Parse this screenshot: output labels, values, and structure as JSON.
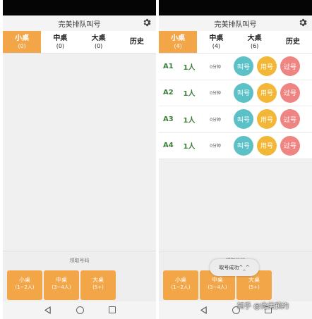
{
  "app_title": "完美排队叫号",
  "left_screen": {
    "tabs": [
      {
        "label": "小桌",
        "count": "(0)"
      },
      {
        "label": "中桌",
        "count": "(0)"
      },
      {
        "label": "大桌",
        "count": "(0)"
      },
      {
        "label": "历史"
      }
    ]
  },
  "right_screen": {
    "tabs": [
      {
        "label": "小桌",
        "count": "(4)"
      },
      {
        "label": "中桌",
        "count": "(4)"
      },
      {
        "label": "大桌",
        "count": "(6)"
      },
      {
        "label": "历史"
      }
    ],
    "queue": [
      {
        "ticket": "A1",
        "people": "1人",
        "wait": "0分钟"
      },
      {
        "ticket": "A2",
        "people": "1人",
        "wait": "0分钟"
      },
      {
        "ticket": "A3",
        "people": "1人",
        "wait": "0分钟"
      },
      {
        "ticket": "A4",
        "people": "1人",
        "wait": "0分钟"
      }
    ],
    "actions": {
      "call": "叫号",
      "use": "用号",
      "pass": "过号"
    },
    "toast": "取号成功^_^"
  },
  "take_number": {
    "label": "领取号码",
    "buttons": [
      {
        "name": "小桌",
        "range": "(1~2人)"
      },
      {
        "name": "中桌",
        "range": "(3~4人)"
      },
      {
        "name": "大桌",
        "range": "(5+)"
      }
    ]
  },
  "watermark": "知乎 @完美预约",
  "icons": {
    "settings": "gear-icon",
    "back": "back-triangle-icon",
    "home": "home-circle-icon",
    "recent": "recent-square-icon"
  },
  "colors": {
    "accent": "#f2a648",
    "call": "#5cc1c6",
    "use": "#f3b738",
    "pass": "#ee8583",
    "ticket_text": "#3e7d3a"
  }
}
